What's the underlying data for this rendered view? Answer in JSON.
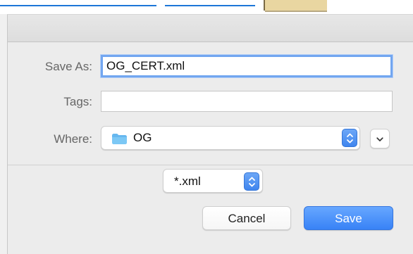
{
  "dialog": {
    "save_as": {
      "label": "Save As:",
      "value": "OG_CERT.xml"
    },
    "tags": {
      "label": "Tags:",
      "value": ""
    },
    "where": {
      "label": "Where:",
      "folder_icon": "folder-icon",
      "value": "OG",
      "selector_icon": "up-down-chevron-icon"
    },
    "expand": {
      "icon": "chevron-down-icon"
    },
    "format": {
      "value": "*.xml",
      "selector_icon": "up-down-chevron-icon"
    },
    "buttons": {
      "cancel": "Cancel",
      "save": "Save"
    }
  },
  "colors": {
    "dialog_background": "#ececec",
    "focus_ring": "#72a6f0",
    "primary_blue": "#3882f6",
    "folder_blue": "#66b7ef",
    "background_link_blue": "#1d76d8",
    "background_swatch": "#e9d6a1"
  }
}
